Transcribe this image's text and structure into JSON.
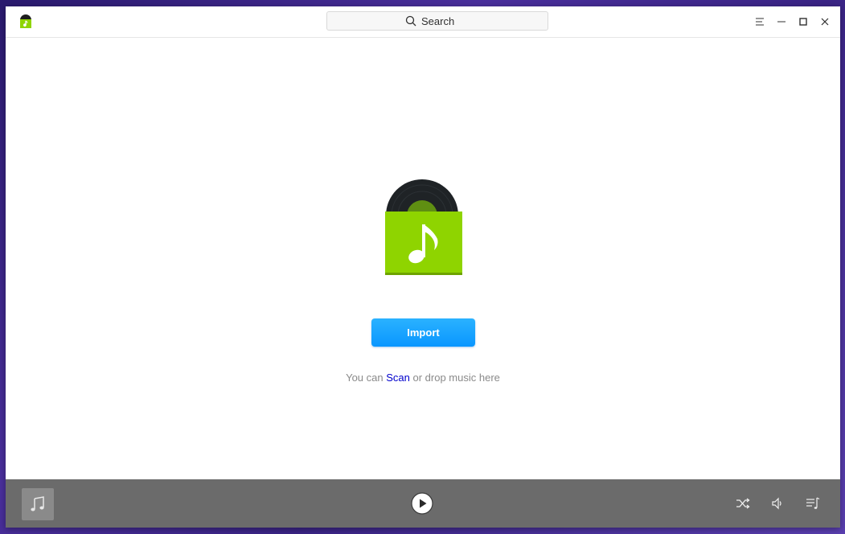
{
  "titlebar": {
    "search_placeholder": "Search",
    "icons": [
      "app-logo-icon",
      "search-icon",
      "menu-icon",
      "minimize-icon",
      "maximize-icon",
      "close-icon"
    ]
  },
  "main": {
    "import_label": "Import",
    "hint_prefix": "You can",
    "hint_link": "Scan",
    "hint_suffix": "or drop music here"
  },
  "player": {
    "icons": [
      "music-note-icon",
      "play-icon",
      "shuffle-icon",
      "volume-icon",
      "playlist-icon"
    ]
  },
  "colors": {
    "accent": "#0a96ff",
    "album_green": "#8fd400",
    "player_bar": "#6b6b6b",
    "link": "#0000cc"
  }
}
